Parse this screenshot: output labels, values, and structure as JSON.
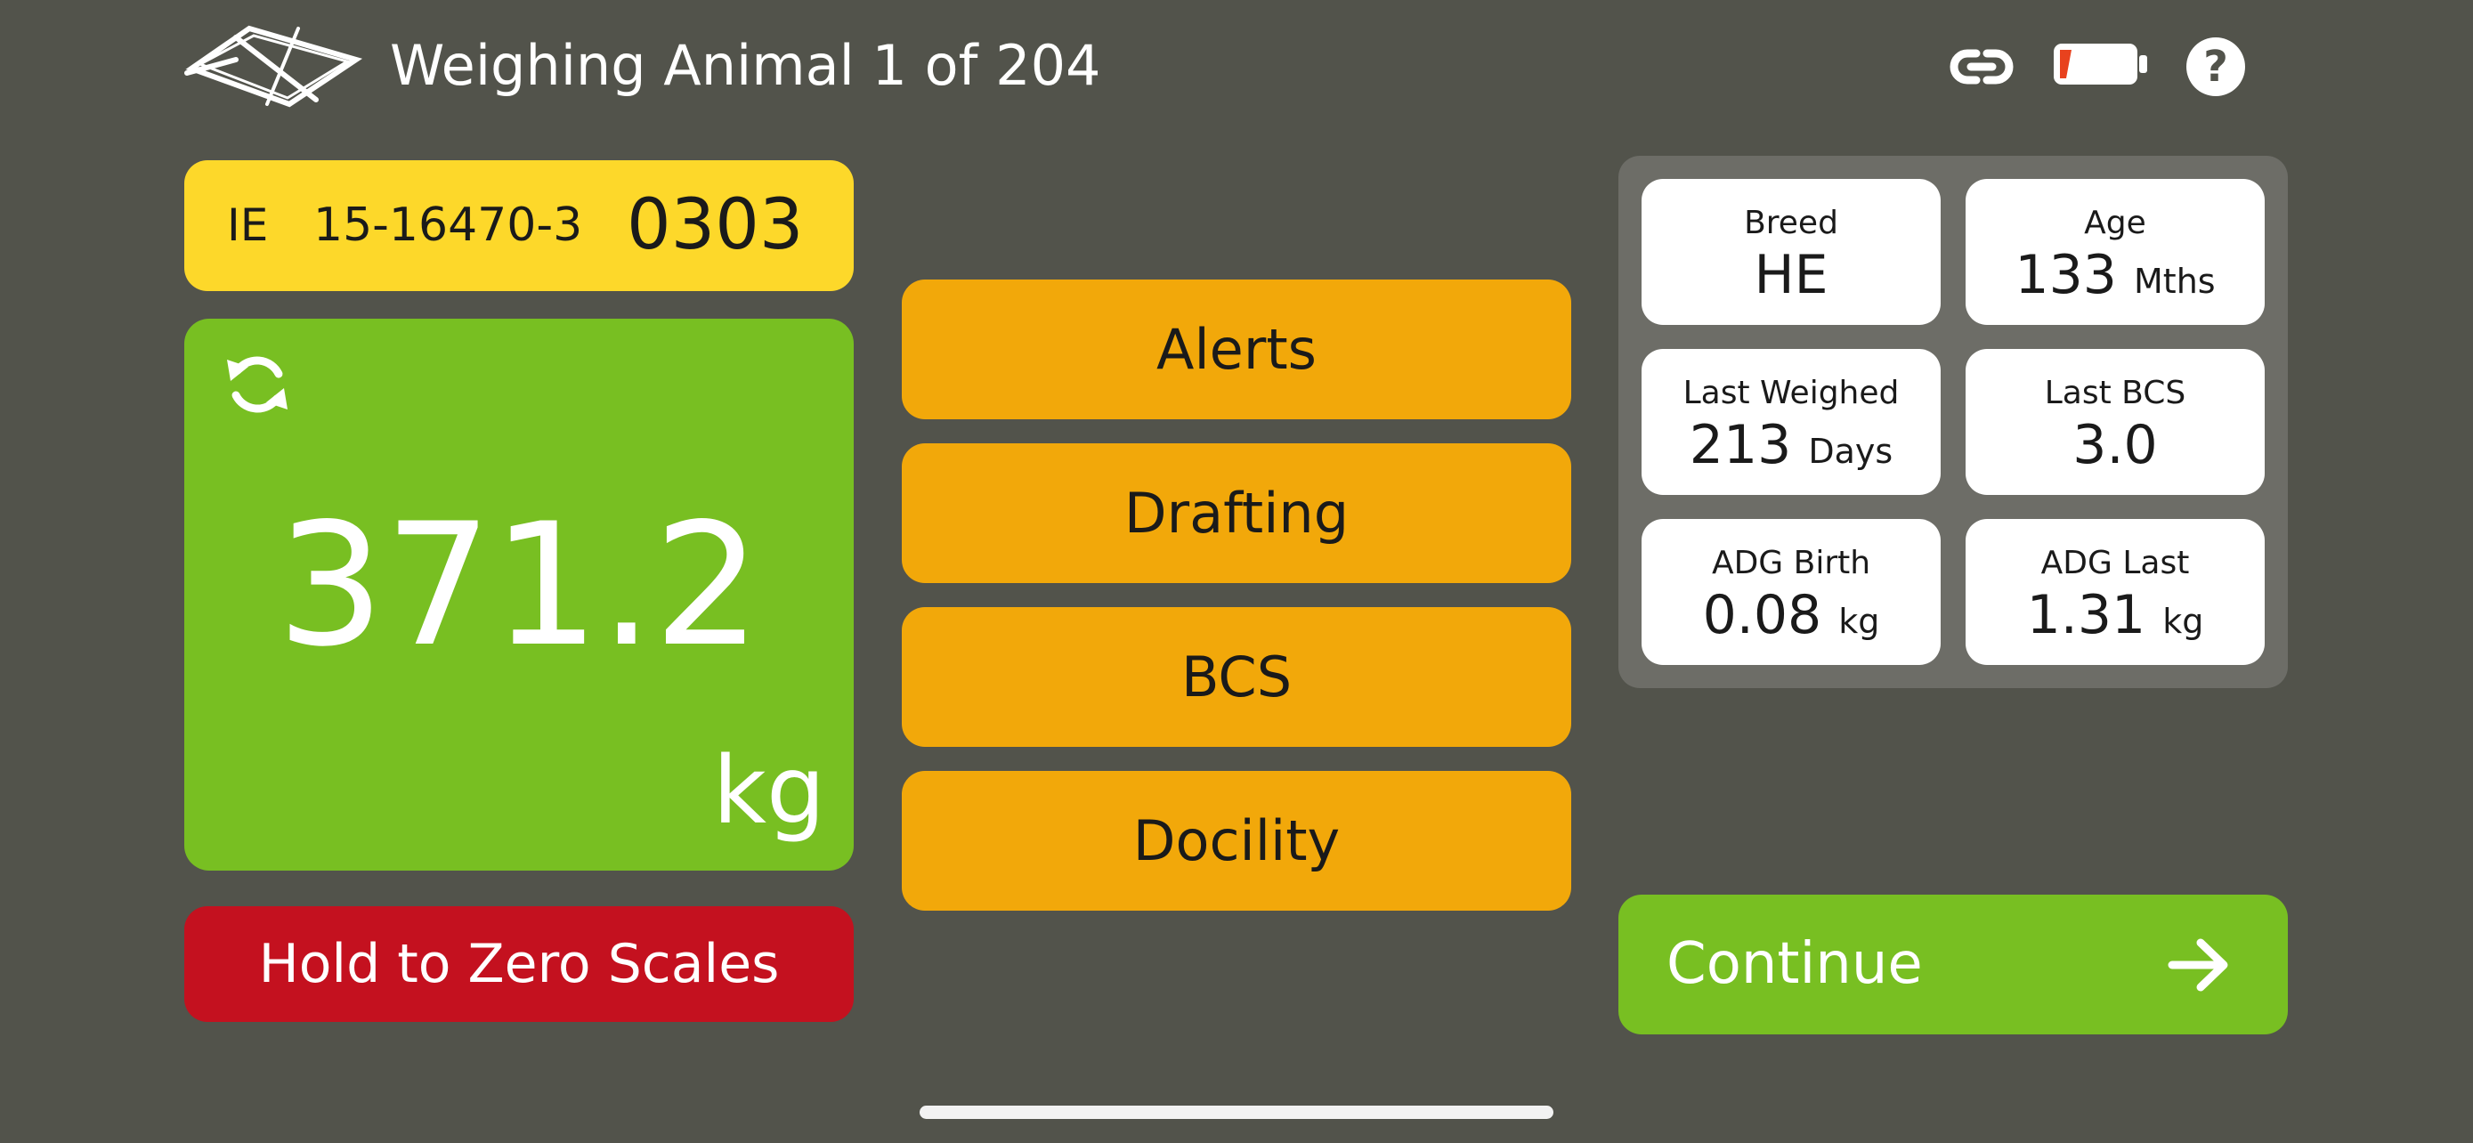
{
  "header": {
    "title": "Weighing Animal 1 of 204",
    "icons": [
      "logo-icon",
      "link-icon",
      "battery-low-icon",
      "help-icon"
    ],
    "help_label": "?"
  },
  "tag": {
    "country": "IE",
    "herd": "15-16470-3",
    "number": "0303"
  },
  "weight": {
    "value": "371.2",
    "unit": "kg"
  },
  "zero_button": {
    "label": "Hold to Zero Scales"
  },
  "actions": {
    "alerts": "Alerts",
    "drafting": "Drafting",
    "bcs": "BCS",
    "docility": "Docility"
  },
  "info": {
    "breed": {
      "label": "Breed",
      "value": "HE",
      "unit": ""
    },
    "age": {
      "label": "Age",
      "value": "133",
      "unit": "Mths"
    },
    "last_weighed": {
      "label": "Last Weighed",
      "value": "213",
      "unit": "Days"
    },
    "last_bcs": {
      "label": "Last BCS",
      "value": "3.0",
      "unit": ""
    },
    "adg_birth": {
      "label": "ADG Birth",
      "value": "0.08",
      "unit": "kg"
    },
    "adg_last": {
      "label": "ADG Last",
      "value": "1.31",
      "unit": "kg"
    }
  },
  "continue_button": {
    "label": "Continue"
  },
  "colors": {
    "background": "#52534b",
    "tag_yellow": "#fdd82a",
    "weight_green": "#78bf22",
    "zero_red": "#c4111f",
    "action_orange": "#f2a80a",
    "battery_red": "#e8421e"
  }
}
